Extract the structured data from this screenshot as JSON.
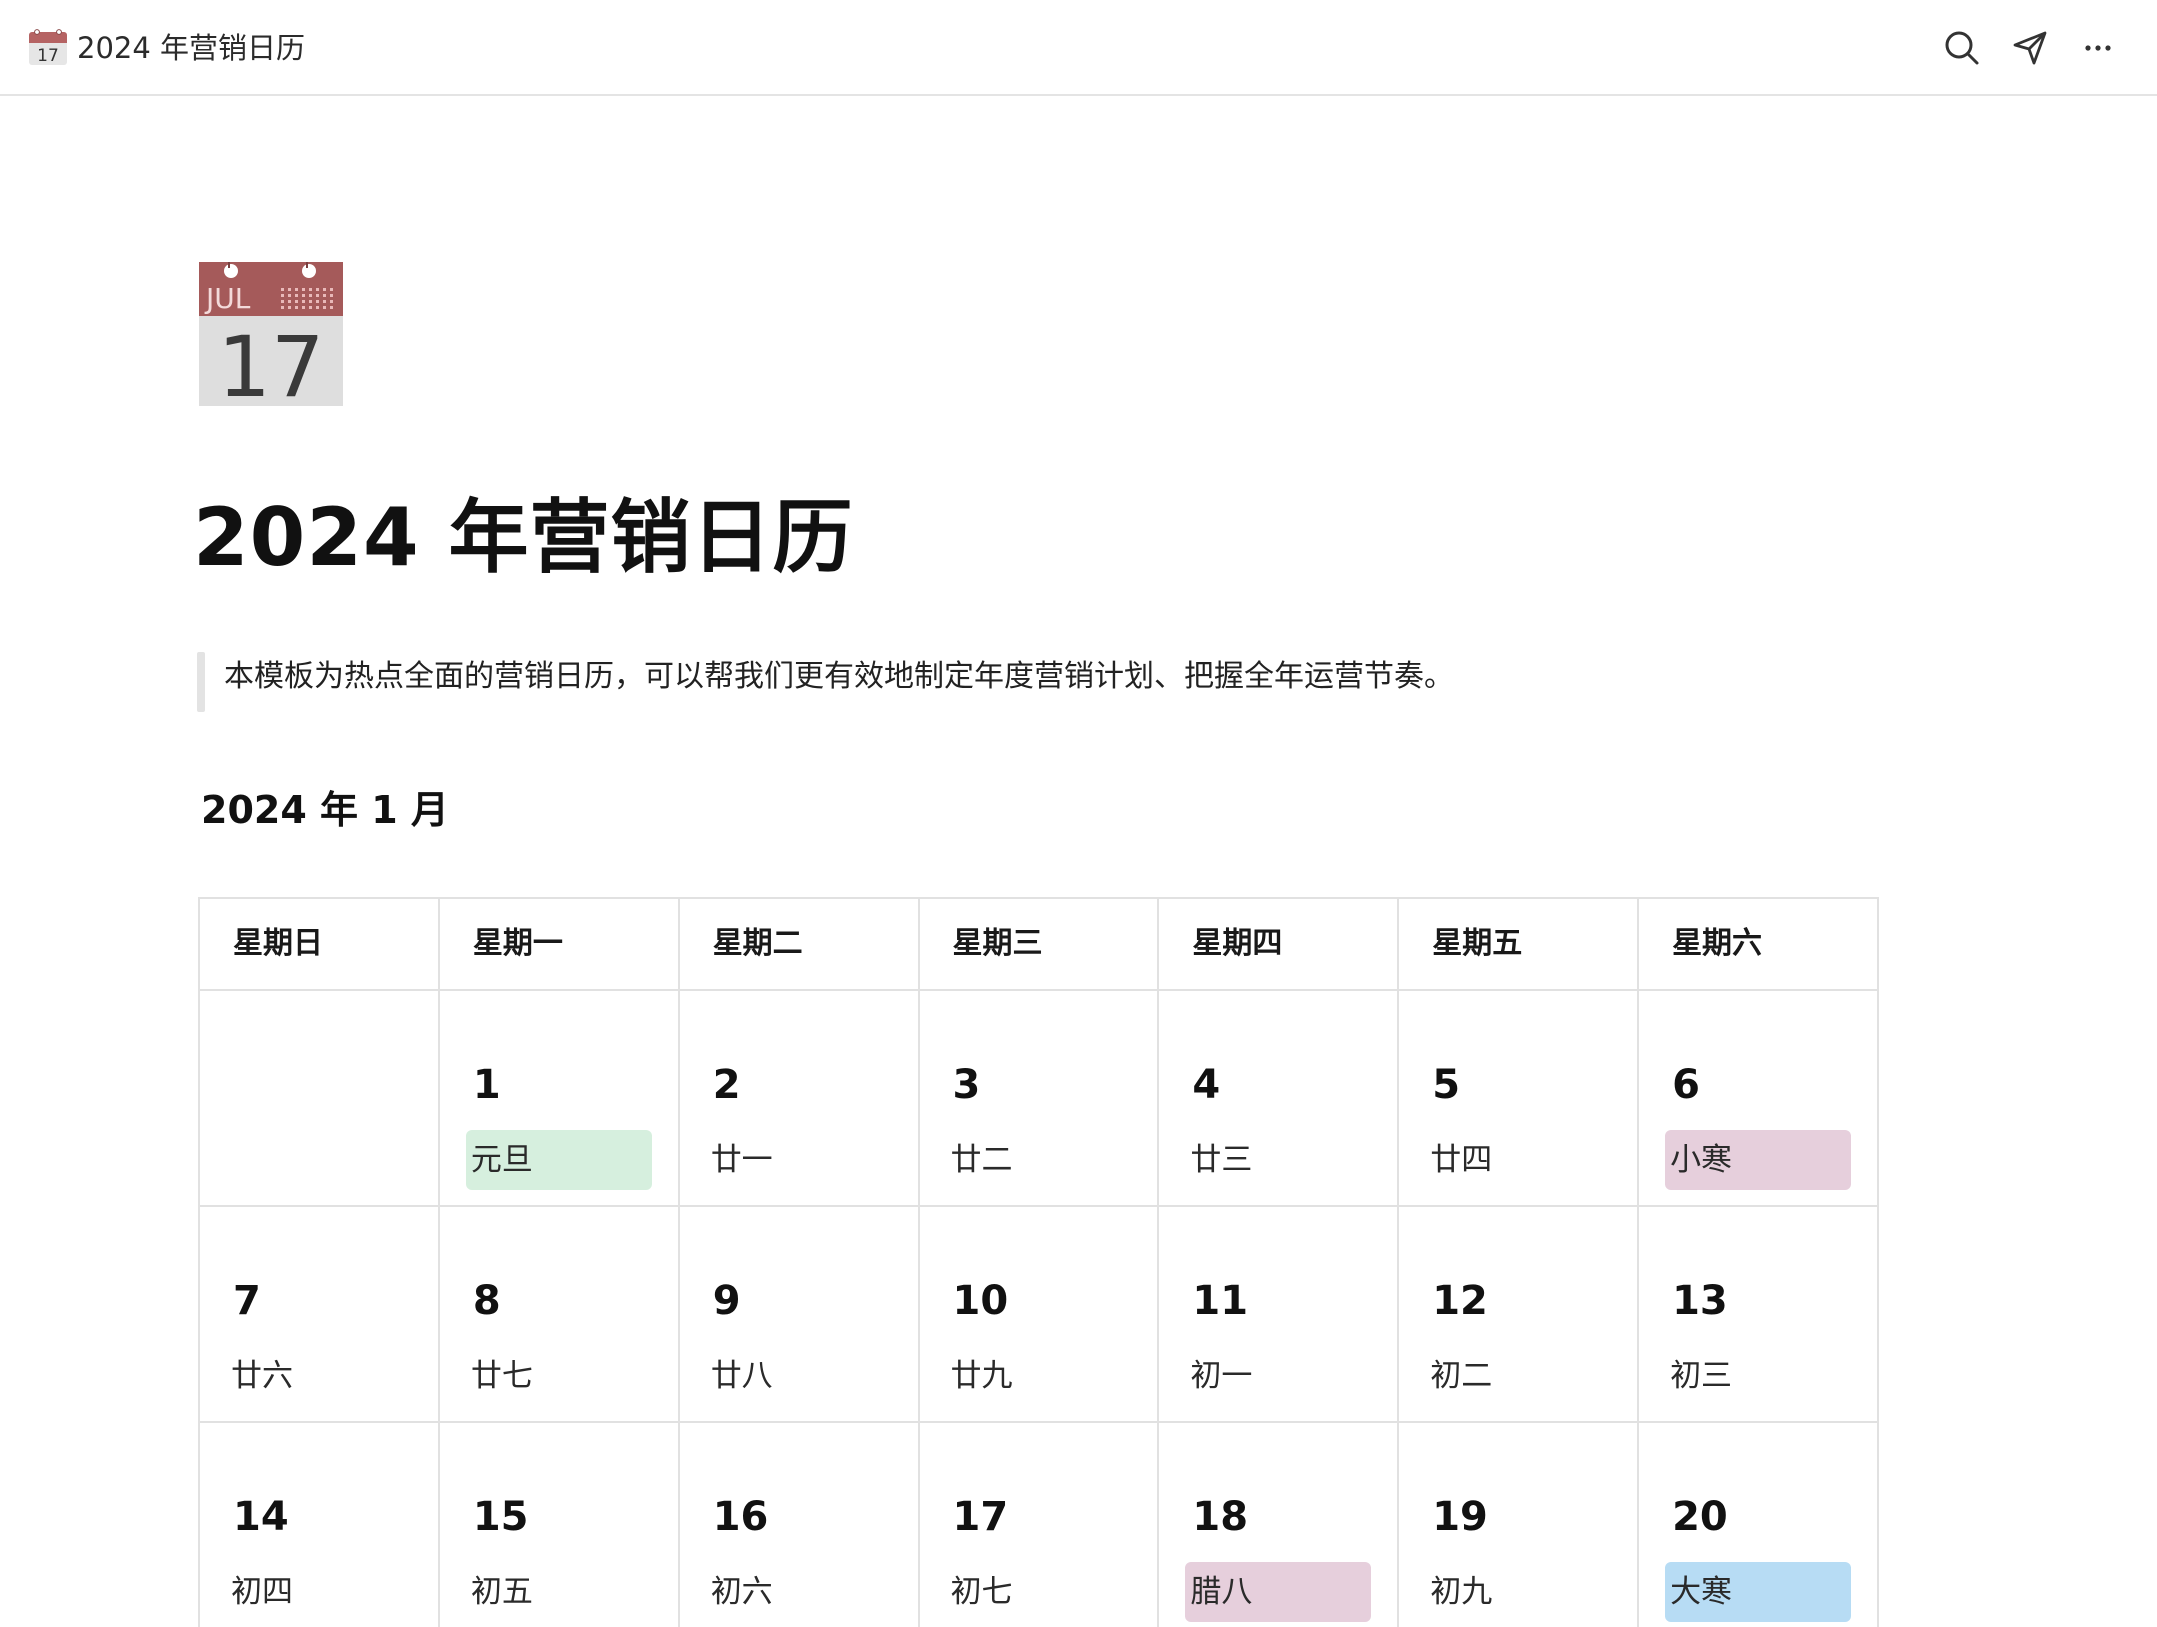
{
  "window": {
    "emoji_icon": "calendar-emoji-icon",
    "title": "2024 年营销日历",
    "actions": [
      {
        "name": "search-icon"
      },
      {
        "name": "share-icon"
      },
      {
        "name": "more-icon"
      }
    ]
  },
  "page": {
    "icon": {
      "name": "calendar-page-icon",
      "month": "JUL",
      "day": "17"
    },
    "title": "2024 年营销日历",
    "quote": "本模板为热点全面的营销日历，可以帮我们更有效地制定年度营销计划、把握全年运营节奏。",
    "month_heading": "2024 年 1 月"
  },
  "calendar": {
    "weekdays": [
      "星期日",
      "星期一",
      "星期二",
      "星期三",
      "星期四",
      "星期五",
      "星期六"
    ],
    "weeks": [
      [
        {
          "day": "",
          "lunar": "",
          "tag": ""
        },
        {
          "day": "1",
          "lunar": "元旦",
          "tag": "green"
        },
        {
          "day": "2",
          "lunar": "廿一",
          "tag": ""
        },
        {
          "day": "3",
          "lunar": "廿二",
          "tag": ""
        },
        {
          "day": "4",
          "lunar": "廿三",
          "tag": ""
        },
        {
          "day": "5",
          "lunar": "廿四",
          "tag": ""
        },
        {
          "day": "6",
          "lunar": "小寒",
          "tag": "pink"
        }
      ],
      [
        {
          "day": "7",
          "lunar": "廿六",
          "tag": ""
        },
        {
          "day": "8",
          "lunar": "廿七",
          "tag": ""
        },
        {
          "day": "9",
          "lunar": "廿八",
          "tag": ""
        },
        {
          "day": "10",
          "lunar": "廿九",
          "tag": ""
        },
        {
          "day": "11",
          "lunar": "初一",
          "tag": ""
        },
        {
          "day": "12",
          "lunar": "初二",
          "tag": ""
        },
        {
          "day": "13",
          "lunar": "初三",
          "tag": ""
        }
      ],
      [
        {
          "day": "14",
          "lunar": "初四",
          "tag": ""
        },
        {
          "day": "15",
          "lunar": "初五",
          "tag": ""
        },
        {
          "day": "16",
          "lunar": "初六",
          "tag": ""
        },
        {
          "day": "17",
          "lunar": "初七",
          "tag": ""
        },
        {
          "day": "18",
          "lunar": "腊八",
          "tag": "pink"
        },
        {
          "day": "19",
          "lunar": "初九",
          "tag": ""
        },
        {
          "day": "20",
          "lunar": "大寒",
          "tag": "blue"
        }
      ]
    ]
  },
  "colors": {
    "tag_green": "#d6efde",
    "tag_pink": "#e6cfdc",
    "tag_blue": "#b7dcf4",
    "calendar_icon_header": "#a55a5a",
    "border": "#e1e1e1"
  }
}
